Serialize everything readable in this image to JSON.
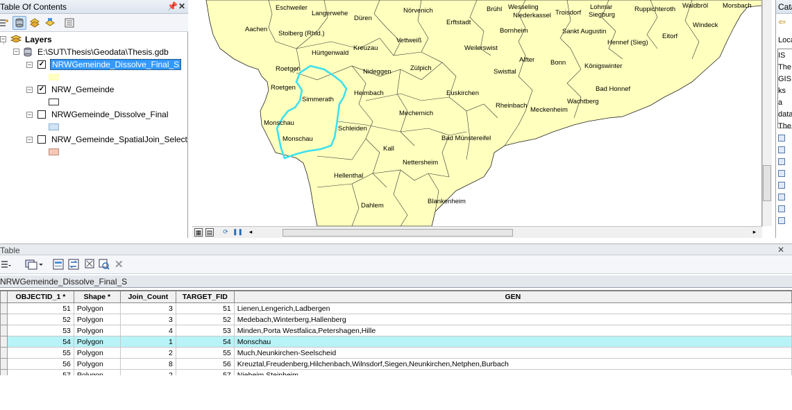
{
  "toc": {
    "title": "Table Of Contents",
    "pin_icon": "pin-icon",
    "close_icon": "close-icon",
    "root_label": "Layers",
    "gdb_path": "E:\\SUT\\Thesis\\Geodata\\Thesis.gdb",
    "layers": [
      {
        "name": "NRWGemeinde_Dissolve_Final_S",
        "checked": true,
        "selected": true,
        "swatch": "#ffffc0"
      },
      {
        "name": "NRW_Gemeinde",
        "checked": true,
        "selected": false,
        "swatch": "#ffffff"
      },
      {
        "name": "NRWGemeinde_Dissolve_Final",
        "checked": false,
        "selected": false,
        "swatch": "#cfe3f5"
      },
      {
        "name": "NRW_Gemeinde_SpatialJoin_Select",
        "checked": false,
        "selected": false,
        "swatch": "#f5c8b8"
      }
    ]
  },
  "map": {
    "fill_color": "#ffffbe",
    "highlight_color": "#3ee0ee",
    "places": [
      "Eschweiler",
      "Langerwehe",
      "Düren",
      "Nörvenich",
      "Brühl",
      "Wesseling",
      "Niederkassel",
      "Troisdorf",
      "Lohmar",
      "Siegburg",
      "Ruppichteroth",
      "Waldbröl",
      "Morsbach",
      "Aachen",
      "Stolberg (Rhld.)",
      "Erftstadt",
      "Bornheim",
      "Sankt Augustin",
      "Eitorf",
      "Windeck",
      "Vettweiß",
      "Kreuzau",
      "Weilerswist",
      "Hennef (Sieg)",
      "Hürtgenwald",
      "Alfter",
      "Bonn",
      "Königswinter",
      "Roetgen",
      "Nideggen",
      "Zülpich",
      "Swisttal",
      "Bad Honnef",
      "Heimbach",
      "Euskirchen",
      "Simmerath",
      "Rheinbach",
      "Wachtberg",
      "Meckenheim",
      "Mechernich",
      "Monschau",
      "Schleiden",
      "Bad Münstereifel",
      "Kall",
      "Nettersheim",
      "Hellenthal",
      "Dahlem",
      "Blankenheim",
      "Roetgen"
    ]
  },
  "catalog": {
    "title": "Cata",
    "location_label": "Loca",
    "text_lines": [
      "IS",
      "The",
      "GIS l",
      "ks",
      "a",
      "data",
      "The"
    ]
  },
  "table": {
    "window_title": "Table",
    "tab_label": "NRWGemeinde_Dissolve_Final_S",
    "columns": [
      "OBJECTID_1 *",
      "Shape *",
      "Join_Count",
      "TARGET_FID",
      "GEN"
    ],
    "rows": [
      {
        "objectid": "51",
        "shape": "Polygon",
        "join_count": "3",
        "target_fid": "51",
        "gen": "Lienen,Lengerich,Ladbergen",
        "highlighted": false
      },
      {
        "objectid": "52",
        "shape": "Polygon",
        "join_count": "3",
        "target_fid": "52",
        "gen": "Medebach,Winterberg,Hallenberg",
        "highlighted": false
      },
      {
        "objectid": "53",
        "shape": "Polygon",
        "join_count": "4",
        "target_fid": "53",
        "gen": "Minden,Porta Westfalica,Petershagen,Hille",
        "highlighted": false
      },
      {
        "objectid": "54",
        "shape": "Polygon",
        "join_count": "1",
        "target_fid": "54",
        "gen": "Monschau",
        "highlighted": true
      },
      {
        "objectid": "55",
        "shape": "Polygon",
        "join_count": "2",
        "target_fid": "55",
        "gen": "Much,Neunkirchen-Seelscheid",
        "highlighted": false
      },
      {
        "objectid": "56",
        "shape": "Polygon",
        "join_count": "8",
        "target_fid": "56",
        "gen": "Kreuztal,Freudenberg,Hilchenbach,Wilnsdorf,Siegen,Neunkirchen,Netphen,Burbach",
        "highlighted": false
      },
      {
        "objectid": "57",
        "shape": "Polygon",
        "join_count": "2",
        "target_fid": "57",
        "gen": "Nieheim,Steinheim",
        "highlighted": false
      }
    ]
  }
}
